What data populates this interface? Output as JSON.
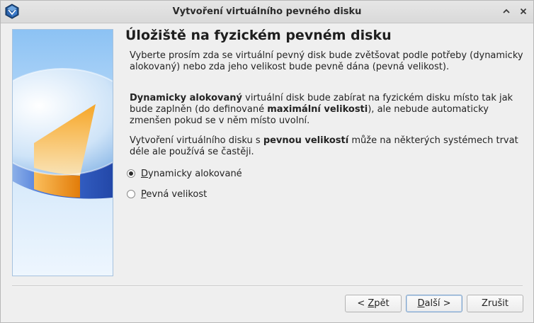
{
  "window": {
    "title": "Vytvoření virtuálního pevného disku"
  },
  "page": {
    "heading": "Úložiště na fyzickém pevném disku",
    "paragraph1": "Vyberte prosím zda se virtuální pevný disk bude zvětšovat podle potřeby (dynamicky alokovaný) nebo zda jeho velikost bude pevně dána (pevná velikost).",
    "paragraph2": {
      "bold1": "Dynamicky alokovaný",
      "text1": " virtuální disk bude zabírat na fyzickém disku místo tak jak bude zaplněn (do definované ",
      "bold2": "maximální velikosti",
      "text2": "), ale nebude automaticky zmenšen pokud se v něm místo uvolní."
    },
    "paragraph3": {
      "text1": "Vytvoření virtuálního disku s ",
      "bold1": "pevnou velikostí",
      "text2": " může na některých systémech trvat déle ale používá se častěji."
    }
  },
  "options": [
    {
      "mnemonic": "D",
      "rest": "ynamicky alokované",
      "selected": true
    },
    {
      "mnemonic": "P",
      "rest": "evná velikost",
      "selected": false
    }
  ],
  "buttons": {
    "back": {
      "prefix": "< ",
      "mnemonic": "Z",
      "rest": "pět"
    },
    "next": {
      "prefix": "",
      "mnemonic": "D",
      "rest": "alší >"
    },
    "cancel": "Zrušit"
  },
  "icons": {
    "app": "virtualbox-icon",
    "titlebar_up": "chevron-up-icon",
    "titlebar_close": "close-icon",
    "side_art": "hard-disk-illustration"
  },
  "colors": {
    "disk_blue": "#3f6fd6",
    "disk_orange": "#f7a21c",
    "selection_border": "#7fa3c9"
  }
}
